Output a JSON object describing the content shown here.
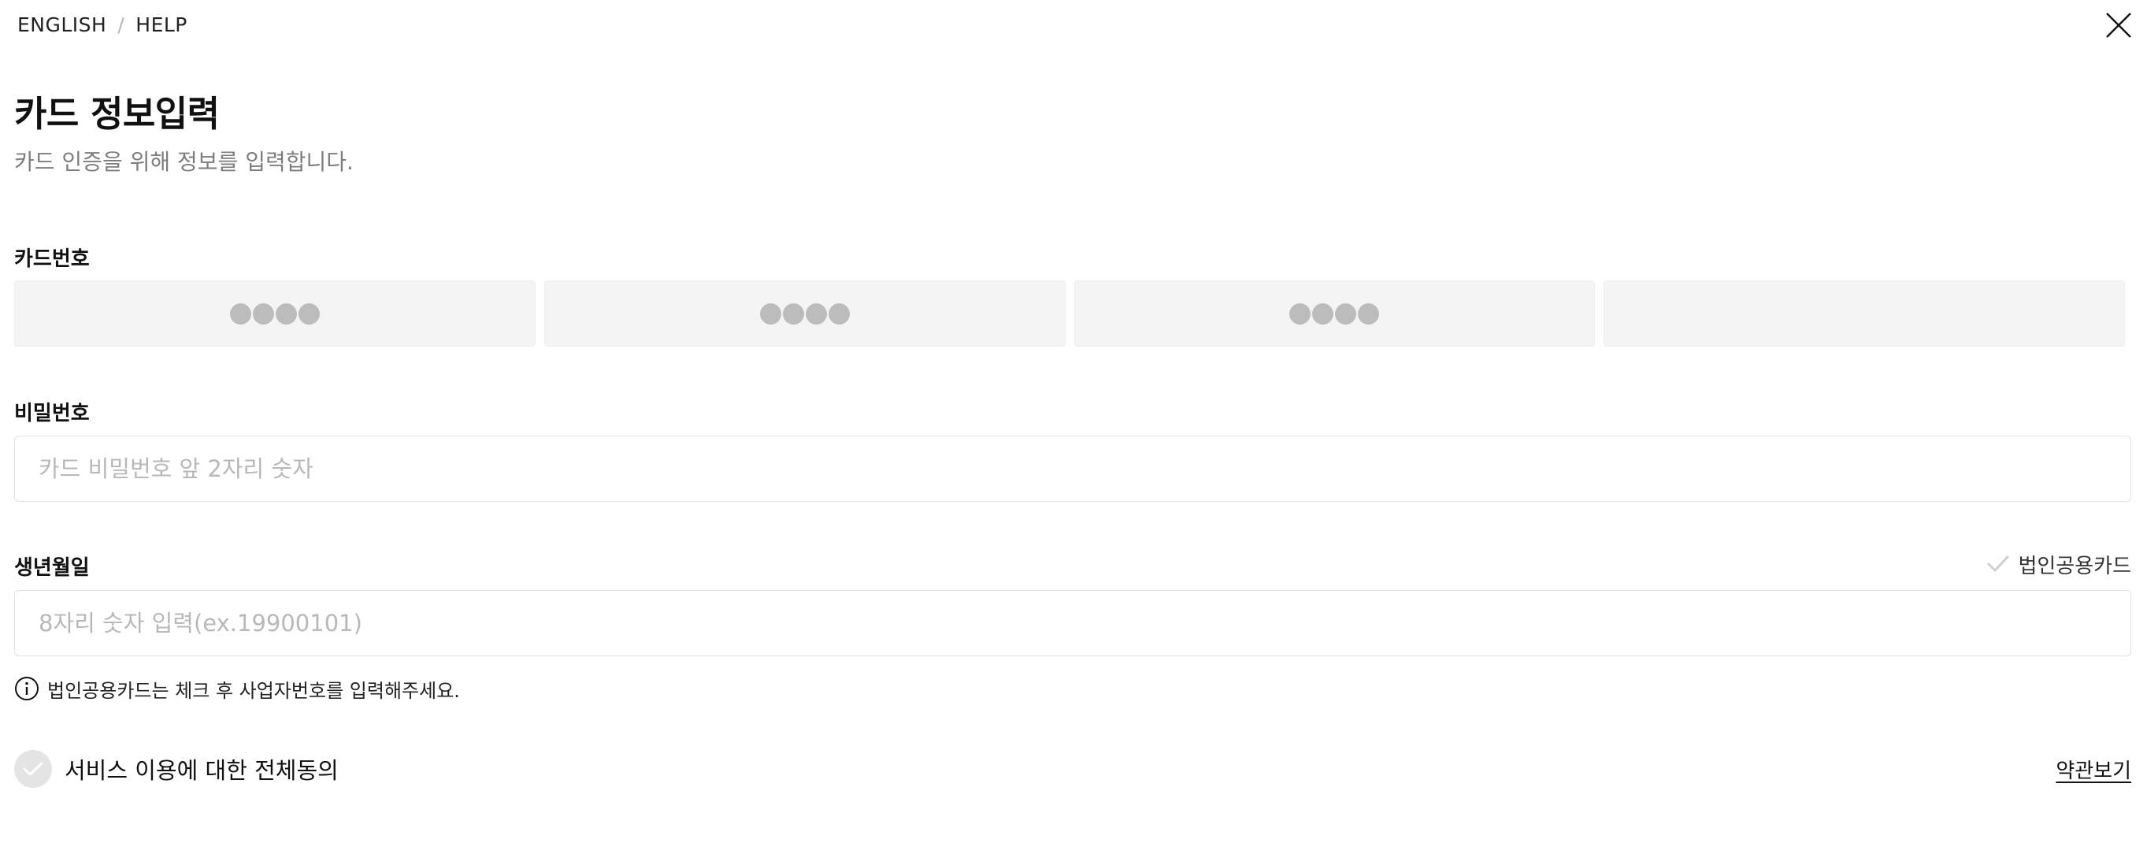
{
  "topnav": {
    "language": "ENGLISH",
    "separator": "/",
    "help": "HELP"
  },
  "header": {
    "title": "카드 정보입력",
    "subtitle": "카드 인증을 위해 정보를 입력합니다."
  },
  "card_number": {
    "label": "카드번호",
    "segments": [
      {
        "masked": true,
        "value": ""
      },
      {
        "masked": true,
        "value": ""
      },
      {
        "masked": true,
        "value": ""
      },
      {
        "masked": false,
        "value": ""
      }
    ]
  },
  "password": {
    "label": "비밀번호",
    "placeholder": "카드 비밀번호 앞 2자리 숫자",
    "value": ""
  },
  "birthdate": {
    "label": "생년월일",
    "placeholder": "8자리 숫자 입력(ex.19900101)",
    "value": "",
    "corporate_card_label": "법인공용카드",
    "corporate_card_checked": false
  },
  "info_notice": "법인공용카드는 체크 후 사업자번호를 입력해주세요.",
  "agreement": {
    "label": "서비스 이용에 대한 전체동의",
    "checked": false,
    "terms_link": "약관보기"
  },
  "colors": {
    "input_bg": "#f4f4f4",
    "dot": "#bcbcbc",
    "muted_text": "#7d7d7d",
    "placeholder": "#b8b8b8",
    "check_inactive": "#cfcfcf"
  },
  "icons": {
    "close": "close-icon",
    "check": "check-icon",
    "info": "info-icon",
    "agree": "check-circle-icon"
  }
}
